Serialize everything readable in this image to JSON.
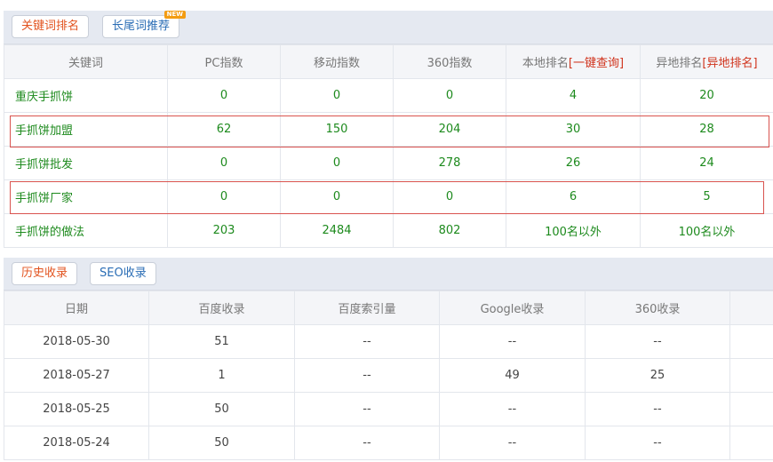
{
  "keyword_tabs": [
    {
      "label": "关键词排名"
    },
    {
      "label": "长尾词推荐",
      "badge": "NEW"
    }
  ],
  "keyword_table": {
    "headers": {
      "keyword": "关键词",
      "pc": "PC指数",
      "mobile": "移动指数",
      "idx360": "360指数",
      "local_prefix": "本地排名",
      "local_link": "[一键查询]",
      "remote_prefix": "异地排名",
      "remote_link": "[异地排名]"
    },
    "rows": [
      {
        "keyword": "重庆手抓饼",
        "pc": "0",
        "mobile": "0",
        "idx360": "0",
        "local": "4",
        "remote": "20"
      },
      {
        "keyword": "手抓饼加盟",
        "pc": "62",
        "mobile": "150",
        "idx360": "204",
        "local": "30",
        "remote": "28"
      },
      {
        "keyword": "手抓饼批发",
        "pc": "0",
        "mobile": "0",
        "idx360": "278",
        "local": "26",
        "remote": "24"
      },
      {
        "keyword": "手抓饼厂家",
        "pc": "0",
        "mobile": "0",
        "idx360": "0",
        "local": "6",
        "remote": "5"
      },
      {
        "keyword": "手抓饼的做法",
        "pc": "203",
        "mobile": "2484",
        "idx360": "802",
        "local": "100名以外",
        "remote": "100名以外"
      }
    ]
  },
  "history_tabs": [
    {
      "label": "历史收录"
    },
    {
      "label": "SEO收录"
    }
  ],
  "history_table": {
    "headers": {
      "date": "日期",
      "baidu": "百度收录",
      "baidu_index": "百度索引量",
      "google": "Google收录",
      "s360": "360收录"
    },
    "rows": [
      {
        "date": "2018-05-30",
        "baidu": "51",
        "baidu_index": "--",
        "google": "--",
        "s360": "--"
      },
      {
        "date": "2018-05-27",
        "baidu": "1",
        "baidu_index": "--",
        "google": "49",
        "s360": "25"
      },
      {
        "date": "2018-05-25",
        "baidu": "50",
        "baidu_index": "--",
        "google": "--",
        "s360": "--"
      },
      {
        "date": "2018-05-24",
        "baidu": "50",
        "baidu_index": "--",
        "google": "--",
        "s360": "--"
      }
    ]
  },
  "colors": {
    "accent": "#e2531f",
    "link": "#2a6db5",
    "value": "#1d8a1d",
    "highlight_border": "#d9534f"
  }
}
